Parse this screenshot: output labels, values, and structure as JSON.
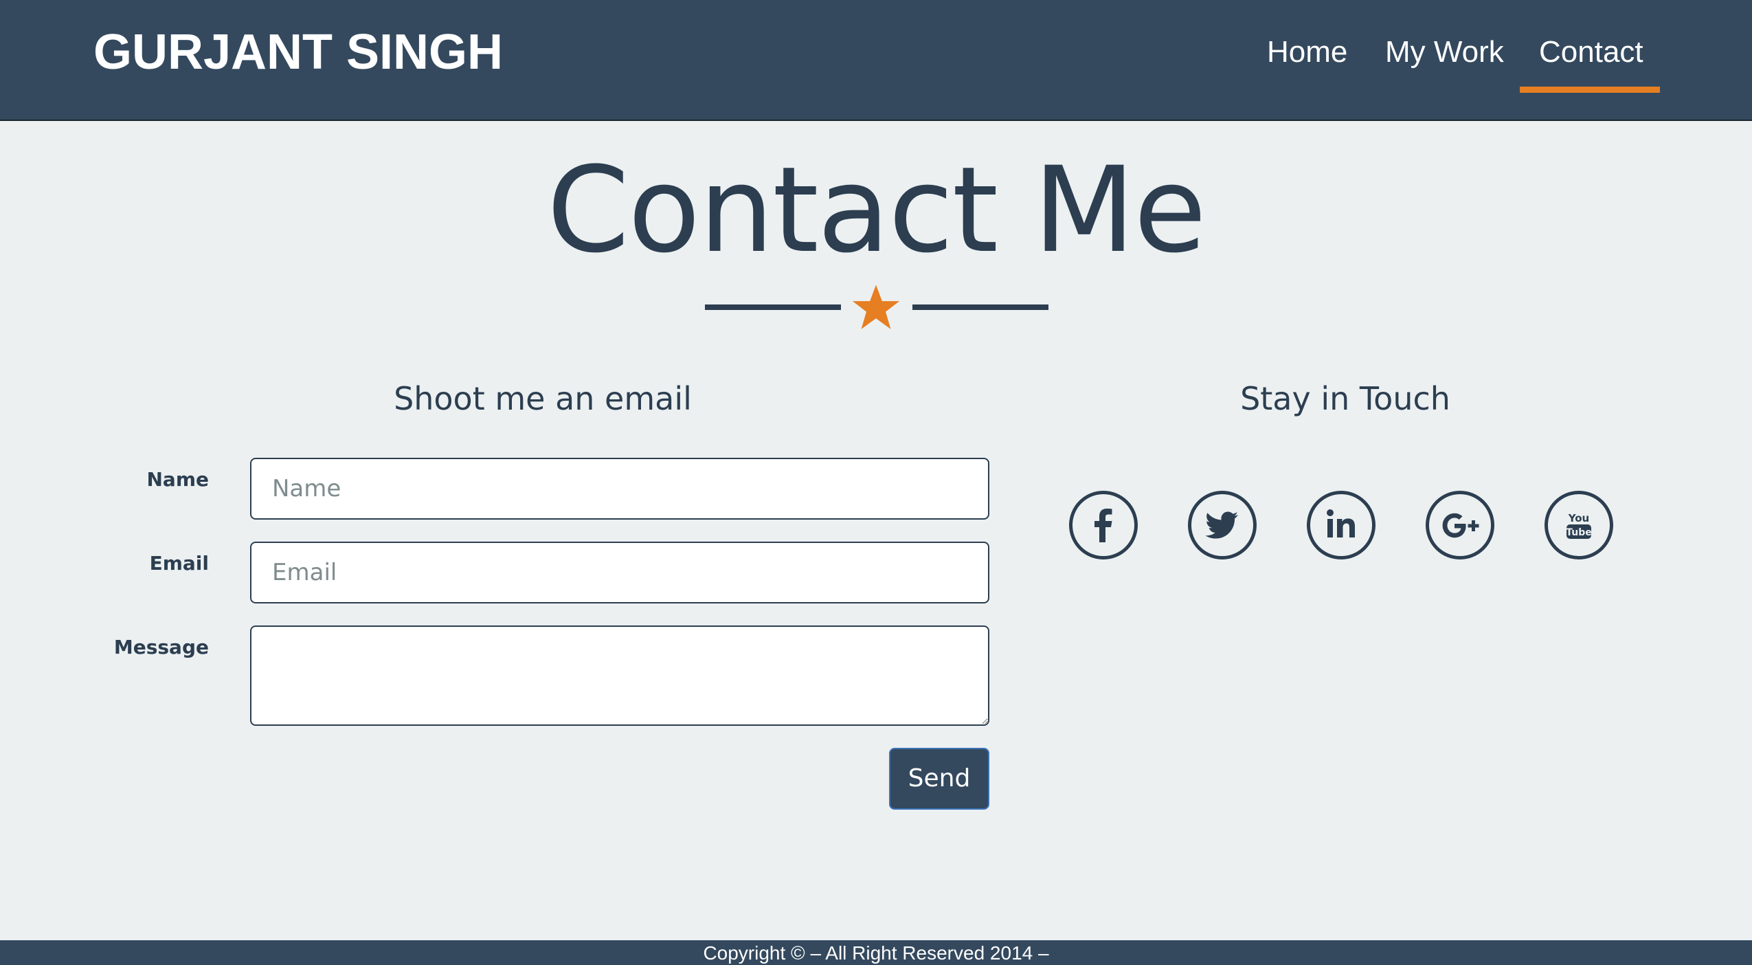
{
  "header": {
    "brand": "GURJANT SINGH",
    "nav": [
      {
        "label": "Home"
      },
      {
        "label": "My Work"
      },
      {
        "label": "Contact",
        "active": true
      }
    ],
    "active_underline_color": "#e67e22"
  },
  "title": {
    "text": "Contact Me",
    "divider_icon": "star-icon",
    "divider_color": "#e67e22"
  },
  "email_section": {
    "heading": "Shoot me an email",
    "fields": {
      "name": {
        "label": "Name",
        "placeholder": "Name",
        "value": ""
      },
      "email": {
        "label": "Email",
        "placeholder": "Email",
        "value": ""
      },
      "message": {
        "label": "Message",
        "placeholder": "",
        "value": ""
      }
    },
    "send_label": "Send"
  },
  "touch_section": {
    "heading": "Stay in Touch",
    "social_icons": [
      "facebook-icon",
      "twitter-icon",
      "linkedin-icon",
      "google-plus-icon",
      "youtube-icon"
    ],
    "youtube_text_top": "You",
    "youtube_text_bottom": "Tube"
  },
  "footer": {
    "text": "Copyright © – All Right Reserved 2014 –"
  },
  "colors": {
    "header_bg": "#34495e",
    "page_bg": "#ecf0f1",
    "text": "#2c3e50",
    "accent": "#e67e22"
  }
}
